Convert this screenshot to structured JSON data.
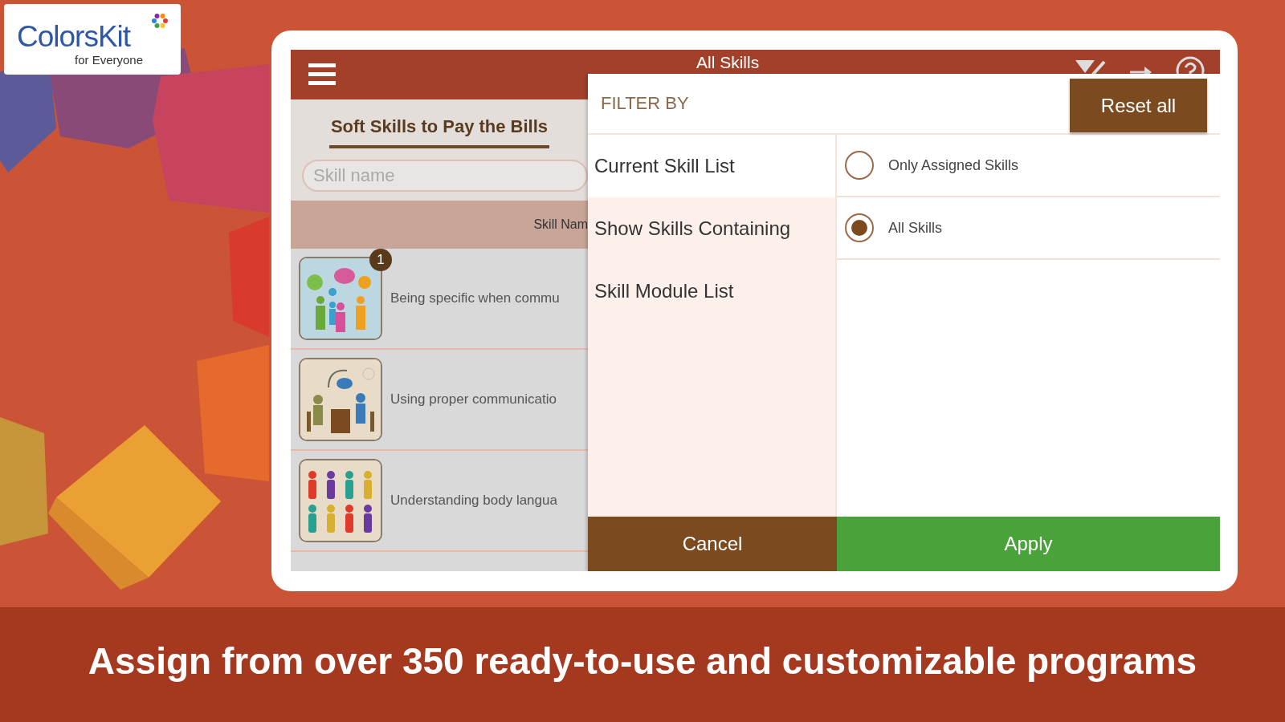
{
  "logo": {
    "name": "ColorsKit",
    "tagline": "for Everyone"
  },
  "app": {
    "title": "All Skills",
    "module_tab": "Soft Skills to Pay the Bills",
    "search": {
      "placeholder": "Skill name"
    },
    "list_header": "Skill Nam",
    "skills": [
      {
        "name": "Being specific when commu",
        "kind": "group",
        "badge": "1"
      },
      {
        "name": "Using proper communicatio",
        "kind": "meeting"
      },
      {
        "name": "Understanding body langua",
        "kind": "crowd"
      }
    ]
  },
  "filter": {
    "heading": "FILTER BY",
    "reset": "Reset all",
    "categories": [
      {
        "label": "Current Skill List",
        "selected": true
      },
      {
        "label": "Show Skills Containing",
        "selected": false
      },
      {
        "label": "Skill Module List",
        "selected": false
      }
    ],
    "options": [
      {
        "label": "Only Assigned Skills",
        "selected": false
      },
      {
        "label": "All Skills",
        "selected": true
      }
    ],
    "cancel": "Cancel",
    "apply": "Apply"
  },
  "caption": "Assign from over 350 ready-to-use and customizable programs"
}
